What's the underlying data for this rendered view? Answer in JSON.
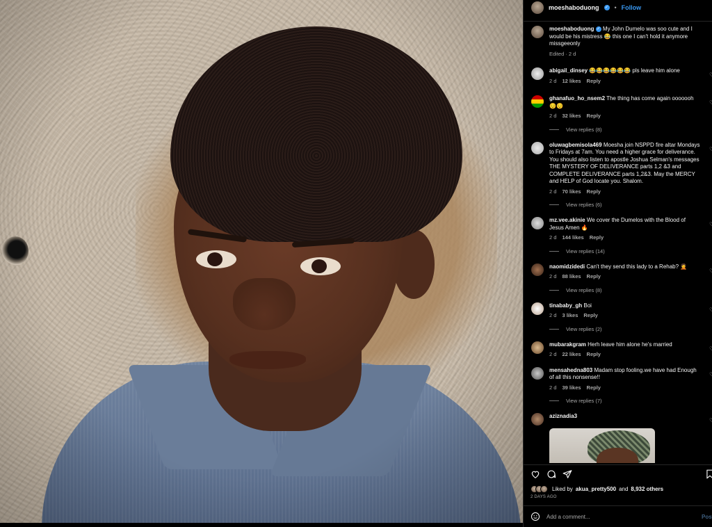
{
  "post": {
    "username": "moeshaboduong",
    "verified_mark": "✓",
    "separator": "•",
    "follow_label": "Follow"
  },
  "caption": {
    "username": "moeshaboduong",
    "text": "My John Dumelo was soo cute and I would be his mistress 😂 this one I can't hold it anymore missgeeonly",
    "meta": "Edited · 2 d"
  },
  "comments": [
    {
      "username": "abigail_dinsey",
      "text": "😂😂😂😂😂😂 pls leave him alone",
      "time": "2 d",
      "likes": "12 likes",
      "reply": "Reply",
      "view_replies": ""
    },
    {
      "username": "ghanafuo_ho_nsem2",
      "text": "The thing has come again ooooooh 😔😔",
      "time": "2 d",
      "likes": "32 likes",
      "reply": "Reply",
      "view_replies": "View replies (8)"
    },
    {
      "username": "oluwagbemisola469",
      "text": "Moesha join NSPPD fire altar Mondays to Fridays at 7am. You need a higher grace for deliverance. You should also listen to apostle Joshua Selman's messages THE MYSTERY OF DELIVERANCE parts 1,2 &3 and COMPLETE DELIVERANCE parts 1,2&3. May the MERCY and HELP of God locate you. Shalom.",
      "time": "2 d",
      "likes": "70 likes",
      "reply": "Reply",
      "view_replies": "View replies (6)"
    },
    {
      "username": "mz.vee.akinie",
      "text": "We cover the Dumelos with the Blood of Jesus Amen 🔥",
      "time": "2 d",
      "likes": "144 likes",
      "reply": "Reply",
      "view_replies": "View replies (14)"
    },
    {
      "username": "naomidzidedi",
      "text": "Can't they send this lady to a Rehab? 🤦",
      "time": "2 d",
      "likes": "88 likes",
      "reply": "Reply",
      "view_replies": "View replies (8)"
    },
    {
      "username": "tinababy_gh",
      "text": "Boi",
      "time": "2 d",
      "likes": "3 likes",
      "reply": "Reply",
      "view_replies": "View replies (2)"
    },
    {
      "username": "mubarakgram",
      "text": "Herh leave him alone he's married",
      "time": "2 d",
      "likes": "22 likes",
      "reply": "Reply",
      "view_replies": ""
    },
    {
      "username": "mensahedna803",
      "text": "Madam stop fooling.we have had Enough of all this nonsense!!",
      "time": "2 d",
      "likes": "39 likes",
      "reply": "Reply",
      "view_replies": "View replies (7)"
    },
    {
      "username": "aziznadia3",
      "text": "",
      "time": "",
      "likes": "",
      "reply": "",
      "view_replies": ""
    }
  ],
  "actions": {
    "like_icon": "heart-icon",
    "comment_icon": "comment-icon",
    "share_icon": "share-icon",
    "save_icon": "bookmark-icon"
  },
  "likes": {
    "prefix": "Liked by",
    "user": "akua_pretty500",
    "middle": "and",
    "others": "8,932 others"
  },
  "timestamp": "2 DAYS AGO",
  "comment_box": {
    "placeholder": "Add a comment...",
    "post_label": "Post"
  },
  "colors": {
    "accent": "#3897f0",
    "background": "#000000",
    "muted_text": "#a8a8a8"
  }
}
